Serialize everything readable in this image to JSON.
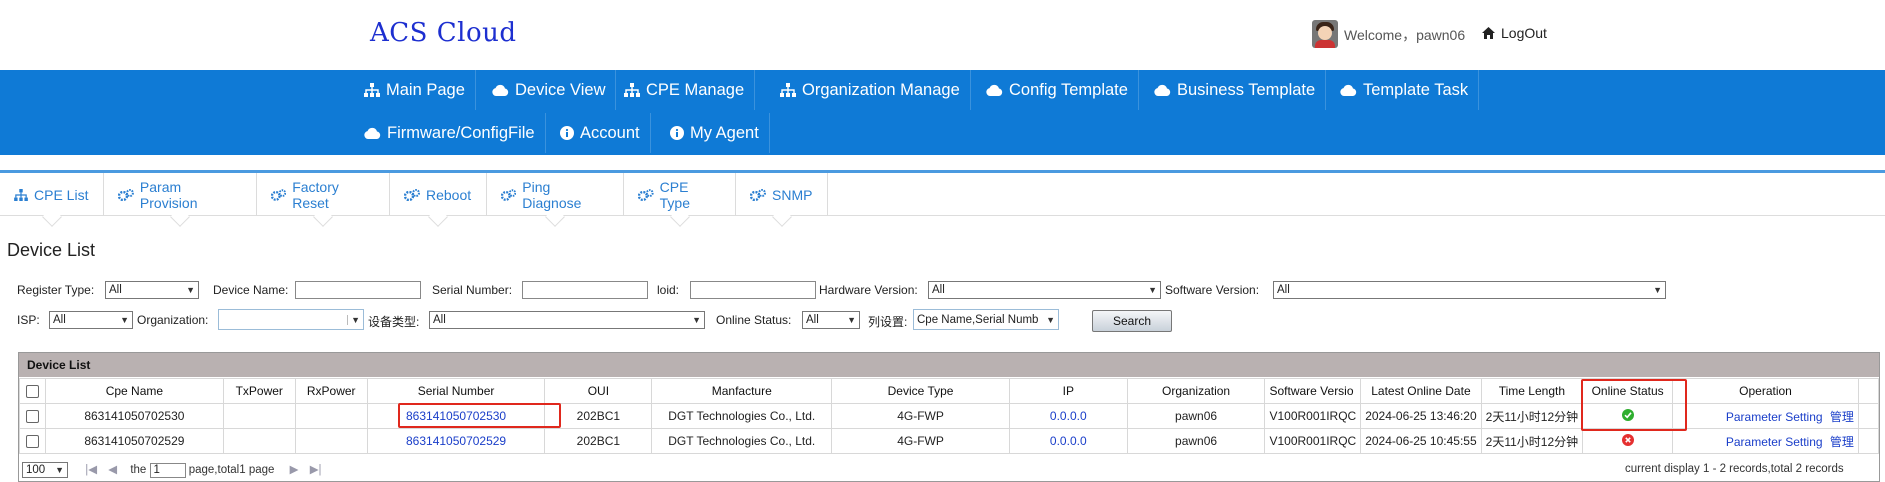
{
  "app": {
    "title": "ACS Cloud"
  },
  "user": {
    "welcome": "Welcome，pawn06",
    "logout": "LogOut"
  },
  "nav": {
    "items": [
      {
        "label": "Main Page",
        "icon": "sitemap-icon"
      },
      {
        "label": "Device View",
        "icon": "cloud-icon"
      },
      {
        "label": "CPE Manage",
        "icon": "sitemap-icon"
      },
      {
        "label": "Organization Manage",
        "icon": "sitemap-icon"
      },
      {
        "label": "Config Template",
        "icon": "cloud-icon"
      },
      {
        "label": "Business Template",
        "icon": "cloud-icon"
      },
      {
        "label": "Template Task",
        "icon": "cloud-icon"
      },
      {
        "label": "Firmware/ConfigFile",
        "icon": "cloud-icon"
      },
      {
        "label": "Account",
        "icon": "info-icon"
      },
      {
        "label": "My Agent",
        "icon": "info-icon"
      }
    ]
  },
  "tabs": [
    {
      "label": "CPE List",
      "icon": "sitemap-icon",
      "active": true
    },
    {
      "label": "Param Provision",
      "icon": "gears-icon"
    },
    {
      "label": "Factory Reset",
      "icon": "gears-icon"
    },
    {
      "label": "Reboot",
      "icon": "gears-icon"
    },
    {
      "label": "Ping Diagnose",
      "icon": "gears-icon"
    },
    {
      "label": "CPE Type",
      "icon": "gears-icon"
    },
    {
      "label": "SNMP",
      "icon": "gears-icon"
    }
  ],
  "page_title": "Device List",
  "filters": {
    "register_type": {
      "label": "Register Type:",
      "value": "All"
    },
    "device_name": {
      "label": "Device Name:",
      "value": ""
    },
    "serial_number": {
      "label": "Serial Number:",
      "value": ""
    },
    "loid": {
      "label": "loid:",
      "value": ""
    },
    "hardware_version": {
      "label": "Hardware Version:",
      "value": "All"
    },
    "software_version": {
      "label": "Software Version:",
      "value": "All"
    },
    "isp": {
      "label": "ISP:",
      "value": "All"
    },
    "organization": {
      "label": "Organization:",
      "value": ""
    },
    "device_type": {
      "label": "设备类型:",
      "value": "All"
    },
    "online_status": {
      "label": "Online Status:",
      "value": "All"
    },
    "columns": {
      "label": "列设置:",
      "value": "Cpe Name,Serial Numb"
    },
    "search_label": "Search"
  },
  "device_list": {
    "header": "Device List",
    "columns": [
      "Cpe Name",
      "TxPower",
      "RxPower",
      "Serial Number",
      "OUI",
      "Manfacture",
      "Device Type",
      "IP",
      "Organization",
      "Software Versio",
      "Latest Online Date",
      "Time Length",
      "Online Status",
      "Operation"
    ],
    "rows": [
      {
        "cpe_name": "863141050702530",
        "txpower": "",
        "rxpower": "",
        "serial": "863141050702530",
        "oui": "202BC1",
        "manufacture": "DGT Technologies Co., Ltd.",
        "device_type": "4G-FWP",
        "ip": "0.0.0.0",
        "organization": "pawn06",
        "software": "V100R001IRQC",
        "latest_online": "2024-06-25 13:46:20",
        "time_length": "2天11小时12分钟",
        "online": true,
        "op_param": "Parameter Setting",
        "op_manage": "管理"
      },
      {
        "cpe_name": "863141050702529",
        "txpower": "",
        "rxpower": "",
        "serial": "863141050702529",
        "oui": "202BC1",
        "manufacture": "DGT Technologies Co., Ltd.",
        "device_type": "4G-FWP",
        "ip": "0.0.0.0",
        "organization": "pawn06",
        "software": "V100R001IRQC",
        "latest_online": "2024-06-25 10:45:55",
        "time_length": "2天11小时12分钟",
        "online": false,
        "op_param": "Parameter Setting",
        "op_manage": "管理"
      }
    ]
  },
  "pager": {
    "page_size": "100",
    "text_before": "the",
    "page_value": "1",
    "text_after": "page,total1 page",
    "status": "current display 1 - 2 records,total 2 records"
  },
  "colors": {
    "nav_bg": "#0f7ad6",
    "logo": "#1d2fd0",
    "link": "#1a3ec9",
    "highlight": "#e0281d",
    "online": "#2fae2f",
    "offline": "#e53030"
  }
}
